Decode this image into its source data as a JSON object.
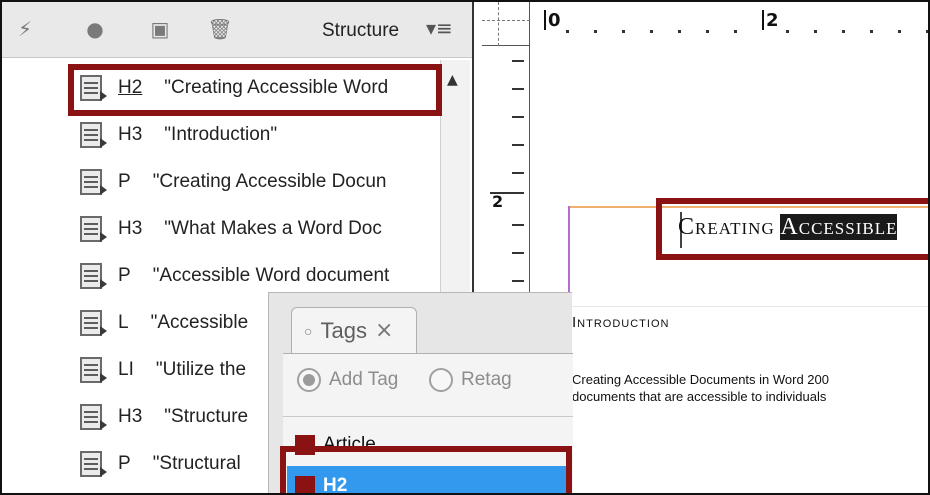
{
  "structure_panel": {
    "title": "Structure",
    "toolbar_icons": [
      "wand-icon",
      "gear-icon",
      "page-icon",
      "trash-icon"
    ],
    "menu_icon": "menu-icon",
    "rows": [
      {
        "tag": "H2",
        "text": "\"Creating Accessible Word",
        "highlighted": true
      },
      {
        "tag": "H3",
        "text": "\"Introduction\""
      },
      {
        "tag": "P",
        "text": "\"Creating Accessible Docun"
      },
      {
        "tag": "H3",
        "text": "\"What Makes a Word Doc"
      },
      {
        "tag": "P",
        "text": "\"Accessible Word document"
      },
      {
        "tag": "L",
        "text": "\"Accessible"
      },
      {
        "tag": "LI",
        "text": "\"Utilize the"
      },
      {
        "tag": "H3",
        "text": "\"Structure"
      },
      {
        "tag": "P",
        "text": "\"Structural"
      }
    ]
  },
  "ruler": {
    "top_labels": [
      "0",
      "2"
    ],
    "left_label": "2"
  },
  "document": {
    "title_plain": "Creating ",
    "title_selected": "Accessible",
    "intro_heading": "Introduction",
    "paragraph_line1": "Creating Accessible Documents in Word 200",
    "paragraph_line2": "documents that are accessible to individuals"
  },
  "tags_panel": {
    "tab_label": "Tags",
    "add_tag_label": "Add Tag",
    "retag_label": "Retag",
    "items": [
      "Article",
      "H2"
    ],
    "selected": "H2"
  },
  "colors": {
    "highlight": "#8a1212",
    "selection_blue": "#3399ee",
    "tag_swatch": "#8a1212"
  }
}
